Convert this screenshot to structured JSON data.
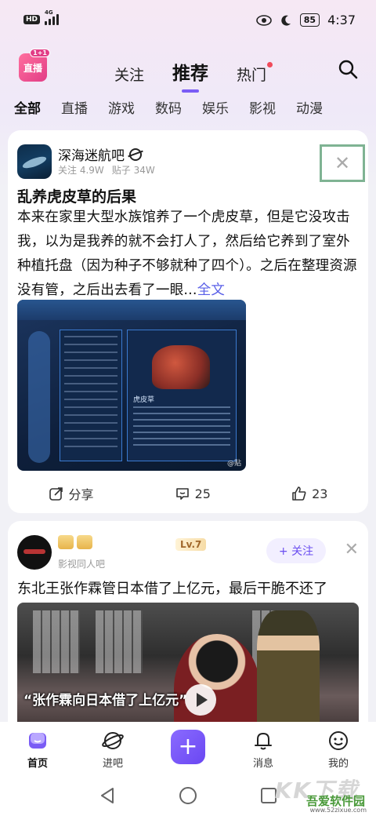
{
  "status_bar": {
    "left_badge": "HD",
    "network": "4G",
    "battery": "85",
    "time": "4:37"
  },
  "header": {
    "logo_text": "直播",
    "logo_badge": "1+1",
    "tabs": [
      {
        "label": "关注",
        "active": false
      },
      {
        "label": "推荐",
        "active": true
      },
      {
        "label": "热门",
        "active": false,
        "has_dot": true
      }
    ]
  },
  "categories": [
    "全部",
    "直播",
    "游戏",
    "数码",
    "娱乐",
    "影视",
    "动漫"
  ],
  "post1": {
    "forum_name": "深海迷航吧",
    "followers": "关注 4.9W",
    "posts": "贴子 34W",
    "title": "乱养虎皮草的后果",
    "body": "本来在家里大型水族馆养了一个虎皮草，但是它没攻击我，以为是我养的就不会打人了，然后给它养到了室外种植托盘（因为种子不够就种了四个）。之后在整理资源没有管，之后出去看了一眼...",
    "more": "全文",
    "image_caption": "虎皮草",
    "image_watermark": "@贴",
    "share_label": "分享",
    "comments": "25",
    "likes": "23"
  },
  "post2": {
    "level": "Lv.7",
    "forum_name": "影视同人吧",
    "follow_label": "+ 关注",
    "title": "东北王张作霖管日本借了上亿元，最后干脆不还了",
    "video_caption": "“张作霖向日本借了上亿元”"
  },
  "bottom_nav": [
    {
      "label": "首页",
      "icon": "home-icon",
      "active": true
    },
    {
      "label": "进吧",
      "icon": "planet-icon",
      "active": false
    },
    {
      "label": "+",
      "icon": "plus-icon",
      "active": false
    },
    {
      "label": "消息",
      "icon": "bell-icon",
      "active": false
    },
    {
      "label": "我的",
      "icon": "profile-icon",
      "active": false
    }
  ],
  "watermark": {
    "big": "KK下载",
    "cn": "吾爱软件园",
    "url": "www.52zixue.com"
  },
  "colors": {
    "accent": "#7a5cf5",
    "link": "#5a60e8",
    "hot_dot": "#f04a5a"
  }
}
